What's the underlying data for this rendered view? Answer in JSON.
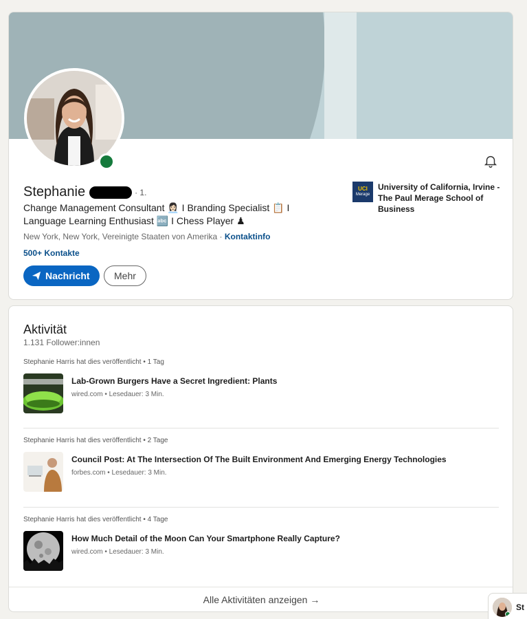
{
  "profile": {
    "name": "Stephanie",
    "degree": "· 1.",
    "headline": "Change Management Consultant 👩🏻‍💼 I Branding Specialist 📋 I Language Learning Enthusiast 🔤 I Chess Player ♟",
    "location": "New York, New York, Vereinigte Staaten von Amerika ·",
    "contact_link": "Kontaktinfo",
    "connections": "500+ Kontakte",
    "message_button": "Nachricht",
    "more_button": "Mehr",
    "education": {
      "logo_text": "UCI",
      "logo_sub": "Merage",
      "name": "University of California, Irvine - The Paul Merage School of Business"
    }
  },
  "activity": {
    "title": "Aktivität",
    "followers": "1.131 Follower:innen",
    "posts": [
      {
        "meta": "Stephanie Harris hat dies veröffentlicht • 1 Tag",
        "title": "Lab-Grown Burgers Have a Secret Ingredient: Plants",
        "source": "wired.com • Lesedauer: 3 Min."
      },
      {
        "meta": "Stephanie Harris hat dies veröffentlicht • 2 Tage",
        "title": "Council Post: At The Intersection Of The Built Environment And Emerging Energy Technologies",
        "source": "forbes.com • Lesedauer: 3 Min."
      },
      {
        "meta": "Stephanie Harris hat dies veröffentlicht • 4 Tage",
        "title": "How Much Detail of the Moon Can Your Smartphone Really Capture?",
        "source": "wired.com • Lesedauer: 3 Min."
      }
    ],
    "show_all": "Alle Aktivitäten anzeigen →"
  },
  "chat": {
    "label": "St"
  },
  "colors": {
    "primary": "#0a66c2",
    "link": "#0a4f8a",
    "online": "#157a3c",
    "banner": "#bfd3d7"
  },
  "icons": [
    "bell-icon",
    "send-icon",
    "arrow-right-icon"
  ]
}
